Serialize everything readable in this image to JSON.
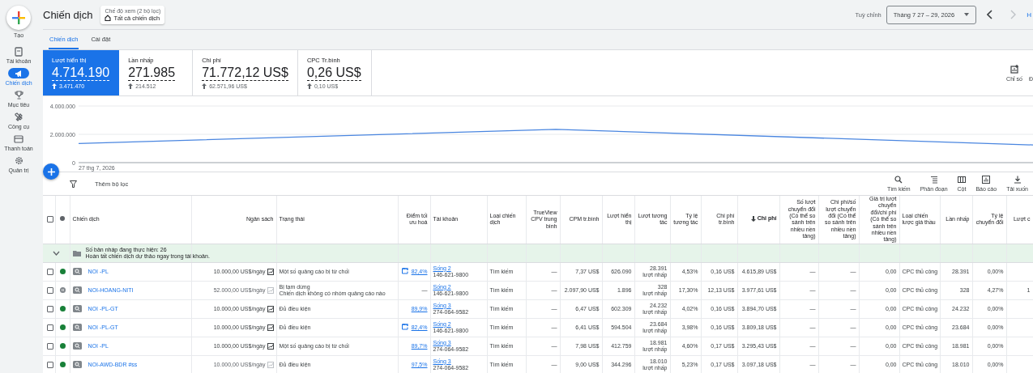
{
  "sidebar": {
    "items": [
      {
        "label": "Tạo",
        "kind": "create",
        "selected": false
      },
      {
        "label": "Tài khoản",
        "kind": "account",
        "selected": false
      },
      {
        "label": "Chiến dịch",
        "kind": "campaigns",
        "selected": true
      },
      {
        "label": "Mục tiêu",
        "kind": "goals",
        "selected": false
      },
      {
        "label": "Công cụ",
        "kind": "tools",
        "selected": false
      },
      {
        "label": "Thanh toán",
        "kind": "billing",
        "selected": false
      },
      {
        "label": "Quản trị",
        "kind": "admin",
        "selected": false
      }
    ]
  },
  "header": {
    "title": "Chiến dịch",
    "view_chip": {
      "caption": "Chế độ xem (2 bộ lọc)",
      "label": "Tất cả chiến dịch"
    },
    "custom_label": "Tuỳ chỉnh",
    "date_range": "Tháng 7 27 – 29, 2026",
    "cut_link": "H"
  },
  "tabs": [
    {
      "label": "Chiến dịch",
      "selected": true
    },
    {
      "label": "Cài đặt",
      "selected": false
    }
  ],
  "scorecards": [
    {
      "label": "Lượt hiển thị",
      "value": "4.714.190",
      "change": "3.471.470",
      "selected": true
    },
    {
      "label": "Lần nhấp",
      "value": "271.985",
      "change": "214.512",
      "selected": false
    },
    {
      "label": "Chi phí",
      "value": "71.772,12 US$",
      "change": "62.571,96 US$",
      "selected": false
    },
    {
      "label": "CPC Tr.bình",
      "value": "0,26 US$",
      "change": "0,10 US$",
      "selected": false
    }
  ],
  "chart_panel": {
    "metrics_button": "Chỉ số",
    "cut_button": "Đ",
    "start_date": "27 thg 7, 2026",
    "chart_data": {
      "type": "line",
      "ylim": [
        0,
        4000000
      ],
      "yticks": [
        {
          "value": 0,
          "label": "0"
        },
        {
          "value": 2000000,
          "label": "2.000.000"
        },
        {
          "value": 4000000,
          "label": "4.000.000"
        }
      ],
      "series": [
        {
          "color": "#4a86e0",
          "values": [
            1350000,
            2350000,
            1250000
          ]
        }
      ]
    }
  },
  "toolbar": {
    "filter_placeholder": "Thêm bộ lọc",
    "actions": [
      {
        "label": "Tìm kiếm",
        "kind": "search"
      },
      {
        "label": "Phân đoạn",
        "kind": "segment"
      },
      {
        "label": "Cột",
        "kind": "columns"
      },
      {
        "label": "Báo cáo",
        "kind": "report"
      },
      {
        "label": "Tải xuốn",
        "kind": "download"
      }
    ]
  },
  "table": {
    "select_all_checked": false,
    "columns": [
      {
        "label": "Chiến dịch",
        "sorted": false
      },
      {
        "label": "Ngân sách",
        "sorted": false
      },
      {
        "label": "Trạng thái",
        "sorted": false
      },
      {
        "label": "Điểm tối ưu hoá",
        "sorted": false
      },
      {
        "label": "Tài khoản",
        "sorted": false
      },
      {
        "label": "Loại chiến dịch",
        "sorted": false
      },
      {
        "label": "TrueView CPV trung bình",
        "sorted": false
      },
      {
        "label": "CPM tr.bình",
        "sorted": false
      },
      {
        "label": "Lượt hiển thị",
        "sorted": false
      },
      {
        "label": "Lượt tương tác",
        "sorted": false
      },
      {
        "label": "Tỷ lệ tương tác",
        "sorted": false
      },
      {
        "label": "Chi phí tr.bình",
        "sorted": false
      },
      {
        "label": "Chi phí",
        "sorted": true
      },
      {
        "label": "Số lượt chuyển đổi (Có thể so sánh trên nhiều nền tảng)",
        "sorted": false
      },
      {
        "label": "Chi phí/số lượt chuyển đổi (Có thể so sánh trên nhiều nền tảng)",
        "sorted": false
      },
      {
        "label": "Giá trị lượt chuyển đổi/chi phí (Có thể so sánh trên nhiều nền tảng)",
        "sorted": false
      },
      {
        "label": "Loại chiến lược giá thầu",
        "sorted": false
      },
      {
        "label": "Lần nhấp",
        "sorted": false
      },
      {
        "label": "Tỷ lệ chuyển đổi",
        "sorted": false
      },
      {
        "label": "Lượt c",
        "sorted": false
      }
    ],
    "group_row": {
      "title": "Số bản nháp đang thực hiện: 26",
      "subtitle": "Hoàn tất chiến dịch dự thảo ngay trong tài khoản."
    },
    "rows": [
      {
        "checked": false,
        "kind": "enabled",
        "color": "#188038",
        "campaign": "NOI -PL",
        "budget": "10.000,00 US$/ngày",
        "budget_icon_disabled": false,
        "state_lines": [
          "Một số quảng cáo bị từ chối"
        ],
        "opt_score": "82,4%",
        "opt_icon": true,
        "account": "Sống 2",
        "account_id": "146-621-9800",
        "type": "Tìm kiếm",
        "trueview": "—",
        "cpm": "7,37 US$",
        "impressions": "626.090",
        "interactions": "28.391",
        "interactions_unit": "lượt nhấp",
        "interaction_rate": "4,53%",
        "avg_cost": "0,16 US$",
        "cost": "4.615,89 US$",
        "conversions": "—",
        "cost_per_conv": "—",
        "conv_value": "0,00",
        "bid_strategy": "CPC thủ công",
        "clicks": "28.391",
        "conv_rate": "0,00%"
      },
      {
        "checked": false,
        "kind": "paused",
        "color": "#80868b",
        "campaign": "NOI-HOANG-NITI",
        "budget": "52.000,00 US$/ngày",
        "budget_icon_disabled": true,
        "state_lines": [
          "Bị tạm dừng",
          "Chiến dịch không có nhóm quảng cáo nào"
        ],
        "opt_score": "—",
        "opt_icon": false,
        "account": "Sống 2",
        "account_id": "146-621-9800",
        "type": "Tìm kiếm",
        "trueview": "—",
        "cpm": "2.097,90 US$",
        "impressions": "1.896",
        "interactions": "328",
        "interactions_unit": "lượt nhấp",
        "interaction_rate": "17,30%",
        "avg_cost": "12,13 US$",
        "cost": "3.977,61 US$",
        "conversions": "—",
        "cost_per_conv": "—",
        "conv_value": "0,00",
        "bid_strategy": "CPC thủ công",
        "clicks": "328",
        "conv_rate": "4,27%",
        "column_22": "1"
      },
      {
        "checked": false,
        "kind": "enabled",
        "color": "#188038",
        "campaign": "NOI -PL-GT",
        "budget": "10.000,00 US$/ngày",
        "budget_icon_disabled": false,
        "state_lines": [
          "Đủ điều kiện"
        ],
        "opt_score": "89,9%",
        "opt_icon": false,
        "account": "Sống 3",
        "account_id": "274-064-9582",
        "type": "Tìm kiếm",
        "trueview": "—",
        "cpm": "6,47 US$",
        "impressions": "602.309",
        "interactions": "24.232",
        "interactions_unit": "lượt nhấp",
        "interaction_rate": "4,02%",
        "avg_cost": "0,16 US$",
        "cost": "3.894,70 US$",
        "conversions": "—",
        "cost_per_conv": "—",
        "conv_value": "0,00",
        "bid_strategy": "CPC thủ công",
        "clicks": "24.232",
        "conv_rate": "0,00%"
      },
      {
        "checked": false,
        "kind": "enabled",
        "color": "#188038",
        "campaign": "NOI -PL-GT",
        "budget": "10.000,00 US$/ngày",
        "budget_icon_disabled": false,
        "state_lines": [
          "Đủ điều kiện"
        ],
        "opt_score": "82,4%",
        "opt_icon": true,
        "account": "Sống 2",
        "account_id": "146-621-9800",
        "type": "Tìm kiếm",
        "trueview": "—",
        "cpm": "6,41 US$",
        "impressions": "594.504",
        "interactions": "23.684",
        "interactions_unit": "lượt nhấp",
        "interaction_rate": "3,98%",
        "avg_cost": "0,16 US$",
        "cost": "3.809,18 US$",
        "conversions": "—",
        "cost_per_conv": "—",
        "conv_value": "0,00",
        "bid_strategy": "CPC thủ công",
        "clicks": "23.684",
        "conv_rate": "0,00%"
      },
      {
        "checked": false,
        "kind": "enabled",
        "color": "#188038",
        "campaign": "NOI -PL",
        "budget": "10.000,00 US$/ngày",
        "budget_icon_disabled": false,
        "state_lines": [
          "Một số quảng cáo bị từ chối"
        ],
        "opt_score": "89,7%",
        "opt_icon": false,
        "account": "Sống 3",
        "account_id": "274-064-9582",
        "type": "Tìm kiếm",
        "trueview": "—",
        "cpm": "7,98 US$",
        "impressions": "412.759",
        "interactions": "18.981",
        "interactions_unit": "lượt nhấp",
        "interaction_rate": "4,60%",
        "avg_cost": "0,17 US$",
        "cost": "3.295,43 US$",
        "conversions": "—",
        "cost_per_conv": "—",
        "conv_value": "0,00",
        "bid_strategy": "CPC thủ công",
        "clicks": "18.981",
        "conv_rate": "0,00%"
      },
      {
        "checked": false,
        "kind": "enabled",
        "color": "#188038",
        "campaign": "NOI-AWD-BDR #ss",
        "budget": "10.000,00 US$/ngày",
        "budget_icon_disabled": true,
        "state_lines": [
          "Đủ điều kiện"
        ],
        "opt_score": "97,5%",
        "opt_icon": false,
        "account": "Sống 3",
        "account_id": "274-064-9582",
        "type": "Tìm kiếm",
        "trueview": "—",
        "cpm": "9,00 US$",
        "impressions": "344.296",
        "interactions": "18.010",
        "interactions_unit": "lượt nhấp",
        "interaction_rate": "5,23%",
        "avg_cost": "0,17 US$",
        "cost": "3.097,18 US$",
        "conversions": "—",
        "cost_per_conv": "—",
        "conv_value": "0,00",
        "bid_strategy": "CPC thủ công",
        "clicks": "18.010",
        "conv_rate": "0,00%"
      }
    ]
  }
}
